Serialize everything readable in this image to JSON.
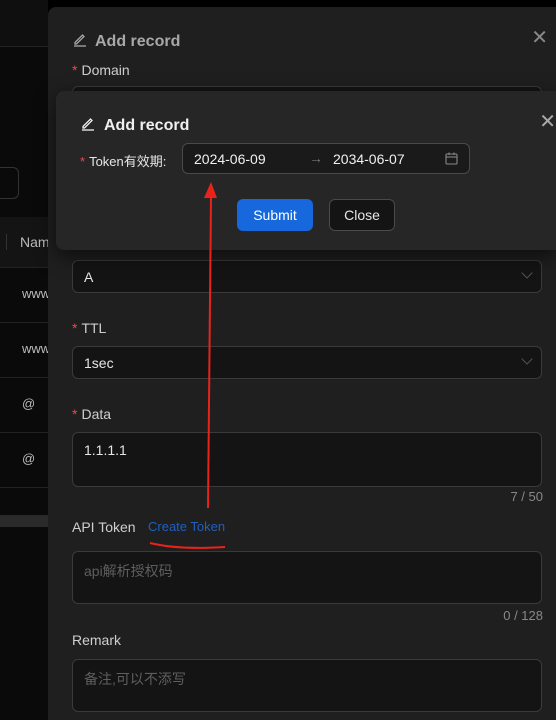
{
  "background_table": {
    "column_header": "Nam",
    "rows": [
      "www",
      "www",
      "@",
      "@"
    ]
  },
  "back_modal": {
    "title": "Add record",
    "domain_label": "Domain",
    "type_value": "A",
    "ttl_label": "TTL",
    "ttl_value": "1sec",
    "data_label": "Data",
    "data_value": "1.1.1.1",
    "data_count": "7 / 50",
    "api_token_label": "API Token",
    "create_token_link": "Create Token",
    "api_token_placeholder": "api解析授权码",
    "api_token_count": "0 / 128",
    "remark_label": "Remark",
    "remark_placeholder": "备注,可以不添写",
    "required_mark": "*"
  },
  "front_modal": {
    "title": "Add record",
    "token_validity_label": "Token有效期:",
    "start_date": "2024-06-09",
    "end_date": "2034-06-07",
    "range_separator": "→",
    "submit_label": "Submit",
    "close_label": "Close",
    "required_mark": "*"
  },
  "icons": {
    "edit": "edit-icon",
    "close": "close-icon",
    "calendar": "calendar-icon",
    "chevron": "chevron-down-icon"
  },
  "colors": {
    "primary": "#1668dc",
    "required": "#e84a4a",
    "link": "#1f5fbf",
    "annotation": "#e8231b"
  }
}
